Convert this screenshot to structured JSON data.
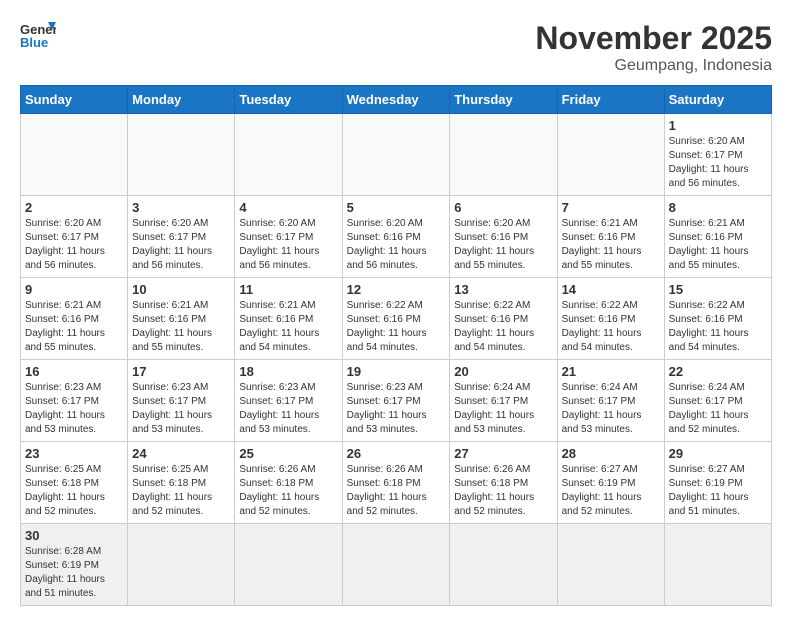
{
  "header": {
    "logo_general": "General",
    "logo_blue": "Blue",
    "title": "November 2025",
    "location": "Geumpang, Indonesia"
  },
  "weekdays": [
    "Sunday",
    "Monday",
    "Tuesday",
    "Wednesday",
    "Thursday",
    "Friday",
    "Saturday"
  ],
  "weeks": [
    [
      {
        "day": null
      },
      {
        "day": null
      },
      {
        "day": null
      },
      {
        "day": null
      },
      {
        "day": null
      },
      {
        "day": null
      },
      {
        "day": "1",
        "sunrise": "Sunrise: 6:20 AM",
        "sunset": "Sunset: 6:17 PM",
        "daylight": "Daylight: 11 hours and 56 minutes."
      }
    ],
    [
      {
        "day": "2",
        "sunrise": "Sunrise: 6:20 AM",
        "sunset": "Sunset: 6:17 PM",
        "daylight": "Daylight: 11 hours and 56 minutes."
      },
      {
        "day": "3",
        "sunrise": "Sunrise: 6:20 AM",
        "sunset": "Sunset: 6:17 PM",
        "daylight": "Daylight: 11 hours and 56 minutes."
      },
      {
        "day": "4",
        "sunrise": "Sunrise: 6:20 AM",
        "sunset": "Sunset: 6:17 PM",
        "daylight": "Daylight: 11 hours and 56 minutes."
      },
      {
        "day": "5",
        "sunrise": "Sunrise: 6:20 AM",
        "sunset": "Sunset: 6:16 PM",
        "daylight": "Daylight: 11 hours and 56 minutes."
      },
      {
        "day": "6",
        "sunrise": "Sunrise: 6:20 AM",
        "sunset": "Sunset: 6:16 PM",
        "daylight": "Daylight: 11 hours and 55 minutes."
      },
      {
        "day": "7",
        "sunrise": "Sunrise: 6:21 AM",
        "sunset": "Sunset: 6:16 PM",
        "daylight": "Daylight: 11 hours and 55 minutes."
      },
      {
        "day": "8",
        "sunrise": "Sunrise: 6:21 AM",
        "sunset": "Sunset: 6:16 PM",
        "daylight": "Daylight: 11 hours and 55 minutes."
      }
    ],
    [
      {
        "day": "9",
        "sunrise": "Sunrise: 6:21 AM",
        "sunset": "Sunset: 6:16 PM",
        "daylight": "Daylight: 11 hours and 55 minutes."
      },
      {
        "day": "10",
        "sunrise": "Sunrise: 6:21 AM",
        "sunset": "Sunset: 6:16 PM",
        "daylight": "Daylight: 11 hours and 55 minutes."
      },
      {
        "day": "11",
        "sunrise": "Sunrise: 6:21 AM",
        "sunset": "Sunset: 6:16 PM",
        "daylight": "Daylight: 11 hours and 54 minutes."
      },
      {
        "day": "12",
        "sunrise": "Sunrise: 6:22 AM",
        "sunset": "Sunset: 6:16 PM",
        "daylight": "Daylight: 11 hours and 54 minutes."
      },
      {
        "day": "13",
        "sunrise": "Sunrise: 6:22 AM",
        "sunset": "Sunset: 6:16 PM",
        "daylight": "Daylight: 11 hours and 54 minutes."
      },
      {
        "day": "14",
        "sunrise": "Sunrise: 6:22 AM",
        "sunset": "Sunset: 6:16 PM",
        "daylight": "Daylight: 11 hours and 54 minutes."
      },
      {
        "day": "15",
        "sunrise": "Sunrise: 6:22 AM",
        "sunset": "Sunset: 6:16 PM",
        "daylight": "Daylight: 11 hours and 54 minutes."
      }
    ],
    [
      {
        "day": "16",
        "sunrise": "Sunrise: 6:23 AM",
        "sunset": "Sunset: 6:17 PM",
        "daylight": "Daylight: 11 hours and 53 minutes."
      },
      {
        "day": "17",
        "sunrise": "Sunrise: 6:23 AM",
        "sunset": "Sunset: 6:17 PM",
        "daylight": "Daylight: 11 hours and 53 minutes."
      },
      {
        "day": "18",
        "sunrise": "Sunrise: 6:23 AM",
        "sunset": "Sunset: 6:17 PM",
        "daylight": "Daylight: 11 hours and 53 minutes."
      },
      {
        "day": "19",
        "sunrise": "Sunrise: 6:23 AM",
        "sunset": "Sunset: 6:17 PM",
        "daylight": "Daylight: 11 hours and 53 minutes."
      },
      {
        "day": "20",
        "sunrise": "Sunrise: 6:24 AM",
        "sunset": "Sunset: 6:17 PM",
        "daylight": "Daylight: 11 hours and 53 minutes."
      },
      {
        "day": "21",
        "sunrise": "Sunrise: 6:24 AM",
        "sunset": "Sunset: 6:17 PM",
        "daylight": "Daylight: 11 hours and 53 minutes."
      },
      {
        "day": "22",
        "sunrise": "Sunrise: 6:24 AM",
        "sunset": "Sunset: 6:17 PM",
        "daylight": "Daylight: 11 hours and 52 minutes."
      }
    ],
    [
      {
        "day": "23",
        "sunrise": "Sunrise: 6:25 AM",
        "sunset": "Sunset: 6:18 PM",
        "daylight": "Daylight: 11 hours and 52 minutes."
      },
      {
        "day": "24",
        "sunrise": "Sunrise: 6:25 AM",
        "sunset": "Sunset: 6:18 PM",
        "daylight": "Daylight: 11 hours and 52 minutes."
      },
      {
        "day": "25",
        "sunrise": "Sunrise: 6:26 AM",
        "sunset": "Sunset: 6:18 PM",
        "daylight": "Daylight: 11 hours and 52 minutes."
      },
      {
        "day": "26",
        "sunrise": "Sunrise: 6:26 AM",
        "sunset": "Sunset: 6:18 PM",
        "daylight": "Daylight: 11 hours and 52 minutes."
      },
      {
        "day": "27",
        "sunrise": "Sunrise: 6:26 AM",
        "sunset": "Sunset: 6:18 PM",
        "daylight": "Daylight: 11 hours and 52 minutes."
      },
      {
        "day": "28",
        "sunrise": "Sunrise: 6:27 AM",
        "sunset": "Sunset: 6:19 PM",
        "daylight": "Daylight: 11 hours and 52 minutes."
      },
      {
        "day": "29",
        "sunrise": "Sunrise: 6:27 AM",
        "sunset": "Sunset: 6:19 PM",
        "daylight": "Daylight: 11 hours and 51 minutes."
      }
    ],
    [
      {
        "day": "30",
        "sunrise": "Sunrise: 6:28 AM",
        "sunset": "Sunset: 6:19 PM",
        "daylight": "Daylight: 11 hours and 51 minutes."
      },
      {
        "day": null
      },
      {
        "day": null
      },
      {
        "day": null
      },
      {
        "day": null
      },
      {
        "day": null
      },
      {
        "day": null
      }
    ]
  ]
}
